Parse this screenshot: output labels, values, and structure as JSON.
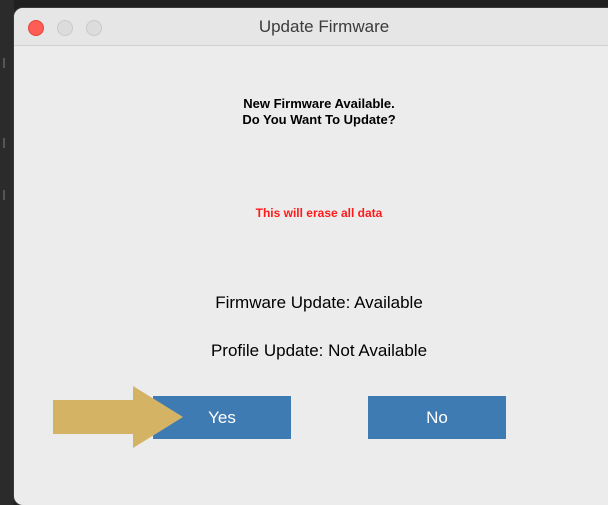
{
  "window": {
    "title": "Update Firmware",
    "controls": [
      "close",
      "minimize",
      "zoom"
    ]
  },
  "dialog": {
    "heading_line1": "New Firmware Available.",
    "heading_line2": "Do You Want To Update?",
    "warning": "This will erase all data",
    "firmware_status": "Firmware Update:  Available",
    "profile_status": "Profile Update:  Not Available"
  },
  "buttons": {
    "yes_label": "Yes",
    "no_label": "No"
  },
  "annotation": {
    "arrow_icon": "right-arrow-icon",
    "arrow_color": "#d4b365"
  },
  "colors": {
    "button_bg": "#3f7bb3",
    "warning_text": "#ff1a1a",
    "close_button": "#fd5d55",
    "window_bg": "#ececec"
  }
}
